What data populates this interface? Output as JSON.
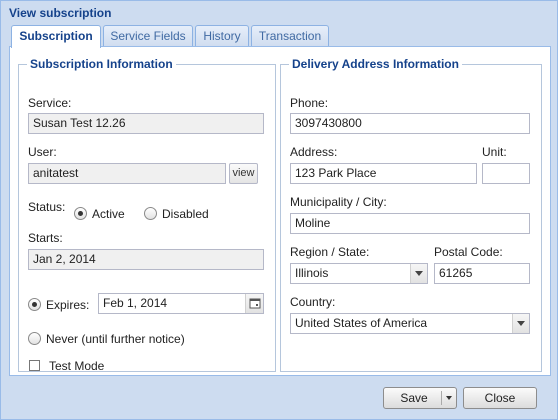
{
  "window": {
    "title": "View subscription"
  },
  "tabs": [
    {
      "label": "Subscription",
      "active": true
    },
    {
      "label": "Service Fields",
      "active": false
    },
    {
      "label": "History",
      "active": false
    },
    {
      "label": "Transaction",
      "active": false
    }
  ],
  "subscription": {
    "legend": "Subscription Information",
    "service_label": "Service:",
    "service_value": "Susan Test 12.26",
    "user_label": "User:",
    "user_value": "anitatest",
    "view_button": "view",
    "status_label": "Status:",
    "status_active": "Active",
    "status_disabled": "Disabled",
    "status_selected": "Active",
    "starts_label": "Starts:",
    "starts_value": "Jan 2, 2014",
    "expires_label": "Expires:",
    "expires_value": "Feb 1, 2014",
    "never_label": "Never (until further notice)",
    "expiry_selected": "Expires",
    "test_mode_label": "Test Mode",
    "test_mode_checked": false
  },
  "delivery": {
    "legend": "Delivery Address Information",
    "phone_label": "Phone:",
    "phone_value": "3097430800",
    "address_label": "Address:",
    "address_value": "123 Park Place",
    "unit_label": "Unit:",
    "unit_value": "",
    "city_label": "Municipality / City:",
    "city_value": "Moline",
    "region_label": "Region / State:",
    "region_value": "Illinois",
    "postal_label": "Postal Code:",
    "postal_value": "61265",
    "country_label": "Country:",
    "country_value": "United States of America"
  },
  "footer": {
    "save_label": "Save",
    "close_label": "Close"
  },
  "icons": {
    "calendar": "calendar-icon",
    "dropdown": "chevron-down-icon"
  },
  "colors": {
    "title": "#15428b",
    "panel_border": "#99bbe8",
    "window_bg": "#cddcf0"
  }
}
